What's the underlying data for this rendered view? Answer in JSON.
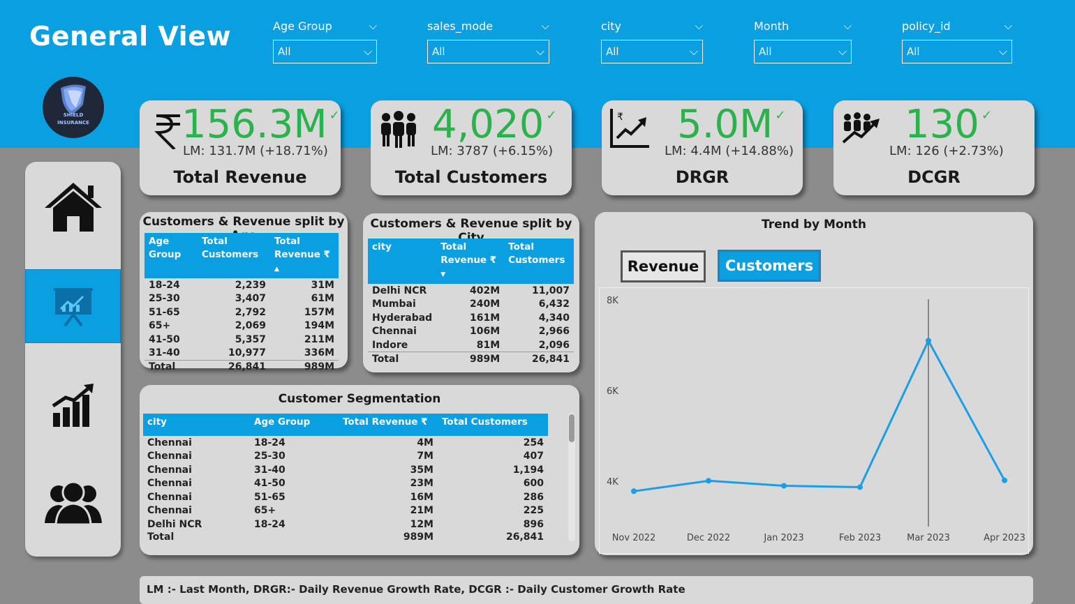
{
  "page": {
    "title": "General View"
  },
  "filters": [
    {
      "label": "Age Group",
      "value": "All"
    },
    {
      "label": "sales_mode",
      "value": "All"
    },
    {
      "label": "city",
      "value": "All"
    },
    {
      "label": "Month",
      "value": "All"
    },
    {
      "label": "policy_id",
      "value": "All"
    }
  ],
  "logo": {
    "line1": "SHIELD",
    "line2": "INSURANCE"
  },
  "nav": [
    {
      "name": "home-icon"
    },
    {
      "name": "presentation-chart-icon"
    },
    {
      "name": "growth-chart-icon"
    },
    {
      "name": "people-group-icon"
    }
  ],
  "kpis": [
    {
      "icon": "rupee-icon",
      "value": "156.3M",
      "lm": "LM: 131.7M (+18.71%)",
      "name": "Total Revenue"
    },
    {
      "icon": "customers-icon",
      "value": "4,020",
      "lm": "LM: 3787 (+6.15%)",
      "name": "Total Customers"
    },
    {
      "icon": "revenue-growth-icon",
      "value": "5.0M",
      "lm": "LM: 4.4M (+14.88%)",
      "name": "DRGR"
    },
    {
      "icon": "customer-growth-icon",
      "value": "130",
      "lm": "LM: 126 (+2.73%)",
      "name": "DCGR"
    }
  ],
  "age_table": {
    "title": "Customers & Revenue split by Age",
    "headers": [
      "Age Group",
      "Total Customers",
      "Total Revenue ₹"
    ],
    "rows": [
      [
        "18-24",
        "2,239",
        "31M"
      ],
      [
        "25-30",
        "3,407",
        "61M"
      ],
      [
        "51-65",
        "2,792",
        "157M"
      ],
      [
        "65+",
        "2,069",
        "194M"
      ],
      [
        "41-50",
        "5,357",
        "211M"
      ],
      [
        "31-40",
        "10,977",
        "336M"
      ]
    ],
    "total": [
      "Total",
      "26,841",
      "989M"
    ]
  },
  "city_table": {
    "title": "Customers & Revenue split by City",
    "headers": [
      "city",
      "Total Revenue ₹",
      "Total Customers"
    ],
    "rows": [
      [
        "Delhi NCR",
        "402M",
        "11,007"
      ],
      [
        "Mumbai",
        "240M",
        "6,432"
      ],
      [
        "Hyderabad",
        "161M",
        "4,340"
      ],
      [
        "Chennai",
        "106M",
        "2,966"
      ],
      [
        "Indore",
        "81M",
        "2,096"
      ]
    ],
    "total": [
      "Total",
      "989M",
      "26,841"
    ]
  },
  "segmentation": {
    "title": "Customer Segmentation",
    "headers": [
      "city",
      "Age Group",
      "Total Revenue ₹",
      "Total Customers"
    ],
    "rows": [
      [
        "Chennai",
        "18-24",
        "4M",
        "254"
      ],
      [
        "Chennai",
        "25-30",
        "7M",
        "407"
      ],
      [
        "Chennai",
        "31-40",
        "35M",
        "1,194"
      ],
      [
        "Chennai",
        "41-50",
        "23M",
        "600"
      ],
      [
        "Chennai",
        "51-65",
        "16M",
        "286"
      ],
      [
        "Chennai",
        "65+",
        "21M",
        "225"
      ],
      [
        "Delhi NCR",
        "18-24",
        "12M",
        "896"
      ]
    ],
    "total": [
      "Total",
      "",
      "989M",
      "26,841"
    ]
  },
  "trend": {
    "title": "Trend by Month",
    "buttons": {
      "revenue": "Revenue",
      "customers": "Customers"
    },
    "selected": "Customers"
  },
  "chart_data": {
    "type": "line",
    "title": "Trend by Month",
    "categories": [
      "Nov 2022",
      "Dec 2022",
      "Jan 2023",
      "Feb 2023",
      "Mar 2023",
      "Apr 2023"
    ],
    "series": [
      {
        "values": [
          3780,
          4010,
          3900,
          3870,
          7100,
          4020
        ]
      }
    ],
    "yticks": [
      "4K",
      "6K",
      "8K"
    ],
    "ytick_values": [
      4000,
      6000,
      8000
    ],
    "ylim": [
      3000,
      8100
    ],
    "highlight_category": "Mar 2023",
    "color": "#1a9ee6",
    "grid": false
  },
  "footer": {
    "text": "LM :- Last Month, DRGR:- Daily Revenue Growth Rate, DCGR :- Daily Customer Growth Rate"
  },
  "colors": {
    "accent": "#0a9fe0",
    "positive": "#2bb24c",
    "panel": "#d9d9d9",
    "background": "#8c8c8c"
  }
}
